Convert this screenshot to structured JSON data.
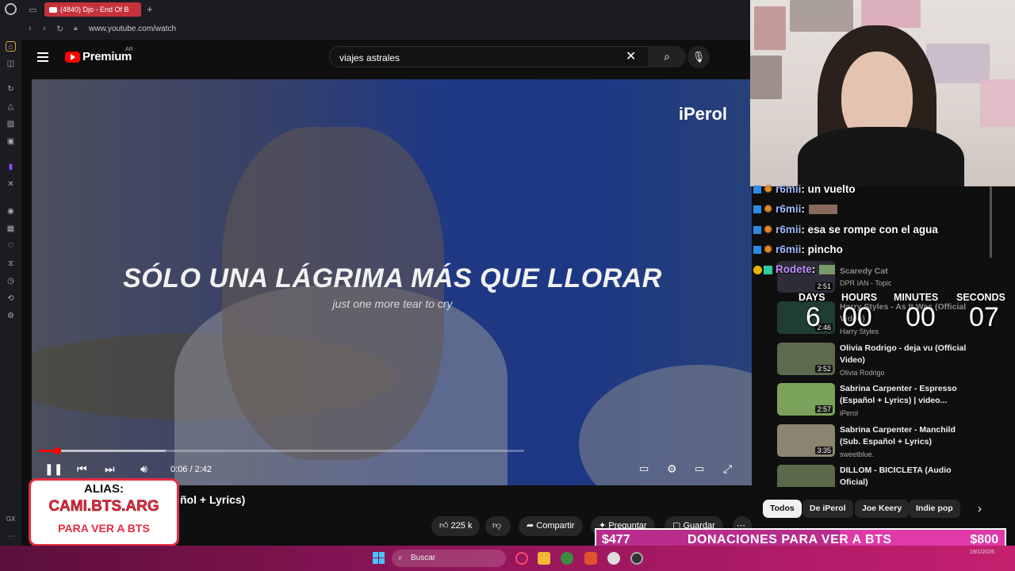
{
  "browser": {
    "tab_title": "(4840) Djo - End Of B",
    "url": "www.youtube.com/watch"
  },
  "youtube": {
    "brand": "Premium",
    "region": "AR",
    "search_value": "viajes astrales"
  },
  "video": {
    "watermark": "iPerol",
    "lyric_es": "SÓLO UNA LÁGRIMA MÁS QUE LLORAR",
    "lyric_en": "just one more tear to cry",
    "time": "0:06 / 2:42",
    "progress": 0.037,
    "title_fragment": "ñol + Lyrics)"
  },
  "actions": {
    "likes": "225 k",
    "share": "Compartir",
    "ask": "Preguntar",
    "save": "Guardar"
  },
  "overlay_alias": {
    "line1": "ALIAS:",
    "line2": "CAMI.BTS.ARG",
    "line3": "PARA VER A BTS"
  },
  "chat": [
    {
      "user": "r6mii",
      "msg": ": un vuelto"
    },
    {
      "user": "r6mii",
      "msg": ":"
    },
    {
      "user": "r6mii",
      "msg": ": esa se rompe con el agua"
    },
    {
      "user": "r6mii",
      "msg": ": pincho"
    },
    {
      "user": "Rodete",
      "msg": ":"
    }
  ],
  "countdown": {
    "labels": [
      "DAYS",
      "HOURS",
      "MINUTES",
      "SECONDS"
    ],
    "values": [
      "6",
      "00",
      "00",
      "07"
    ]
  },
  "recommendations": [
    {
      "title": "Scaredy Cat",
      "channel": "DPR IAN - Topic",
      "duration": "2:51"
    },
    {
      "title": "Harry Styles - As It Was (Official Video)",
      "channel": "Harry Styles",
      "duration": "2:46"
    },
    {
      "title": "Olivia Rodrigo - deja vu (Official Video)",
      "channel": "Olivia Rodrigo",
      "duration": "3:52"
    },
    {
      "title": "Sabrina Carpenter - Espresso (Español + Lyrics) | video...",
      "channel": "iPerol",
      "duration": "2:57"
    },
    {
      "title": "Sabrina Carpenter - Manchild (Sub. Español + Lyrics)",
      "channel": "sweetblue.",
      "duration": "3:35"
    },
    {
      "title": "DILLOM - BICICLETA (Audio Oficial)",
      "channel": "",
      "duration": ""
    }
  ],
  "chips": [
    "Todos",
    "De iPerol",
    "Joe Keery",
    "Indie pop"
  ],
  "donations": {
    "current": "$477",
    "label": "DONACIONES PARA VER A BTS",
    "goal": "$800"
  },
  "taskbar": {
    "search_label": "Buscar",
    "date": "19/1/2026"
  },
  "colors": {
    "accent": "#ff0000",
    "donation": "#e03aa8",
    "chat_user": "#9db8ff"
  }
}
